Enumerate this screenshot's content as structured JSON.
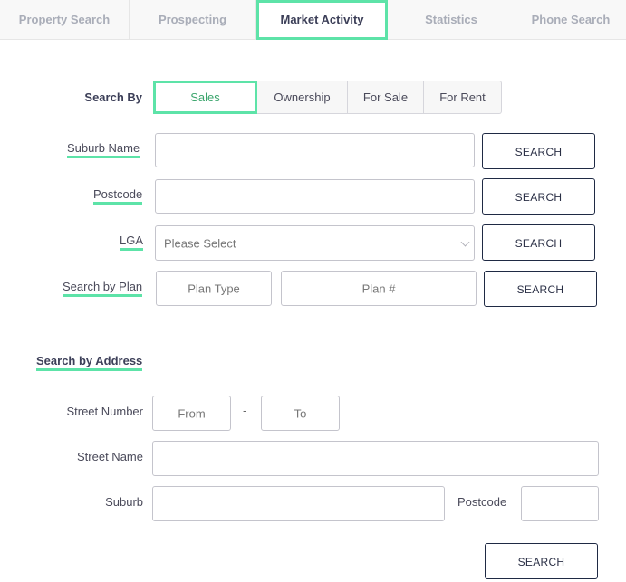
{
  "tabs": [
    {
      "label": "Property Search",
      "active": false
    },
    {
      "label": "Prospecting",
      "active": false
    },
    {
      "label": "Market Activity",
      "active": true
    },
    {
      "label": "Statistics",
      "active": false
    },
    {
      "label": "Phone Search",
      "active": false
    }
  ],
  "search_by": {
    "label": "Search By",
    "options": [
      {
        "label": "Sales",
        "active": true
      },
      {
        "label": "Ownership",
        "active": false
      },
      {
        "label": "For Sale",
        "active": false
      },
      {
        "label": "For Rent",
        "active": false
      }
    ]
  },
  "fields": {
    "suburb_name": {
      "label": "Suburb Name",
      "value": "",
      "button": "SEARCH"
    },
    "postcode": {
      "label": "Postcode",
      "value": "",
      "button": "SEARCH"
    },
    "lga": {
      "label": "LGA",
      "selected": "Please Select",
      "button": "SEARCH"
    },
    "plan": {
      "label": "Search by Plan",
      "plan_type_placeholder": "Plan Type",
      "plan_number_placeholder": "Plan #",
      "button": "SEARCH"
    }
  },
  "address": {
    "heading": "Search by Address",
    "street_number": {
      "label": "Street Number",
      "from_placeholder": "From",
      "separator": "-",
      "to_placeholder": "To"
    },
    "street_name": {
      "label": "Street Name",
      "value": ""
    },
    "suburb": {
      "label": "Suburb",
      "value": ""
    },
    "postcode": {
      "label": "Postcode",
      "value": ""
    },
    "button": "SEARCH"
  },
  "colors": {
    "accent": "#5de3a8",
    "active_text": "#3aa56c",
    "button_border": "#1f2a44"
  }
}
